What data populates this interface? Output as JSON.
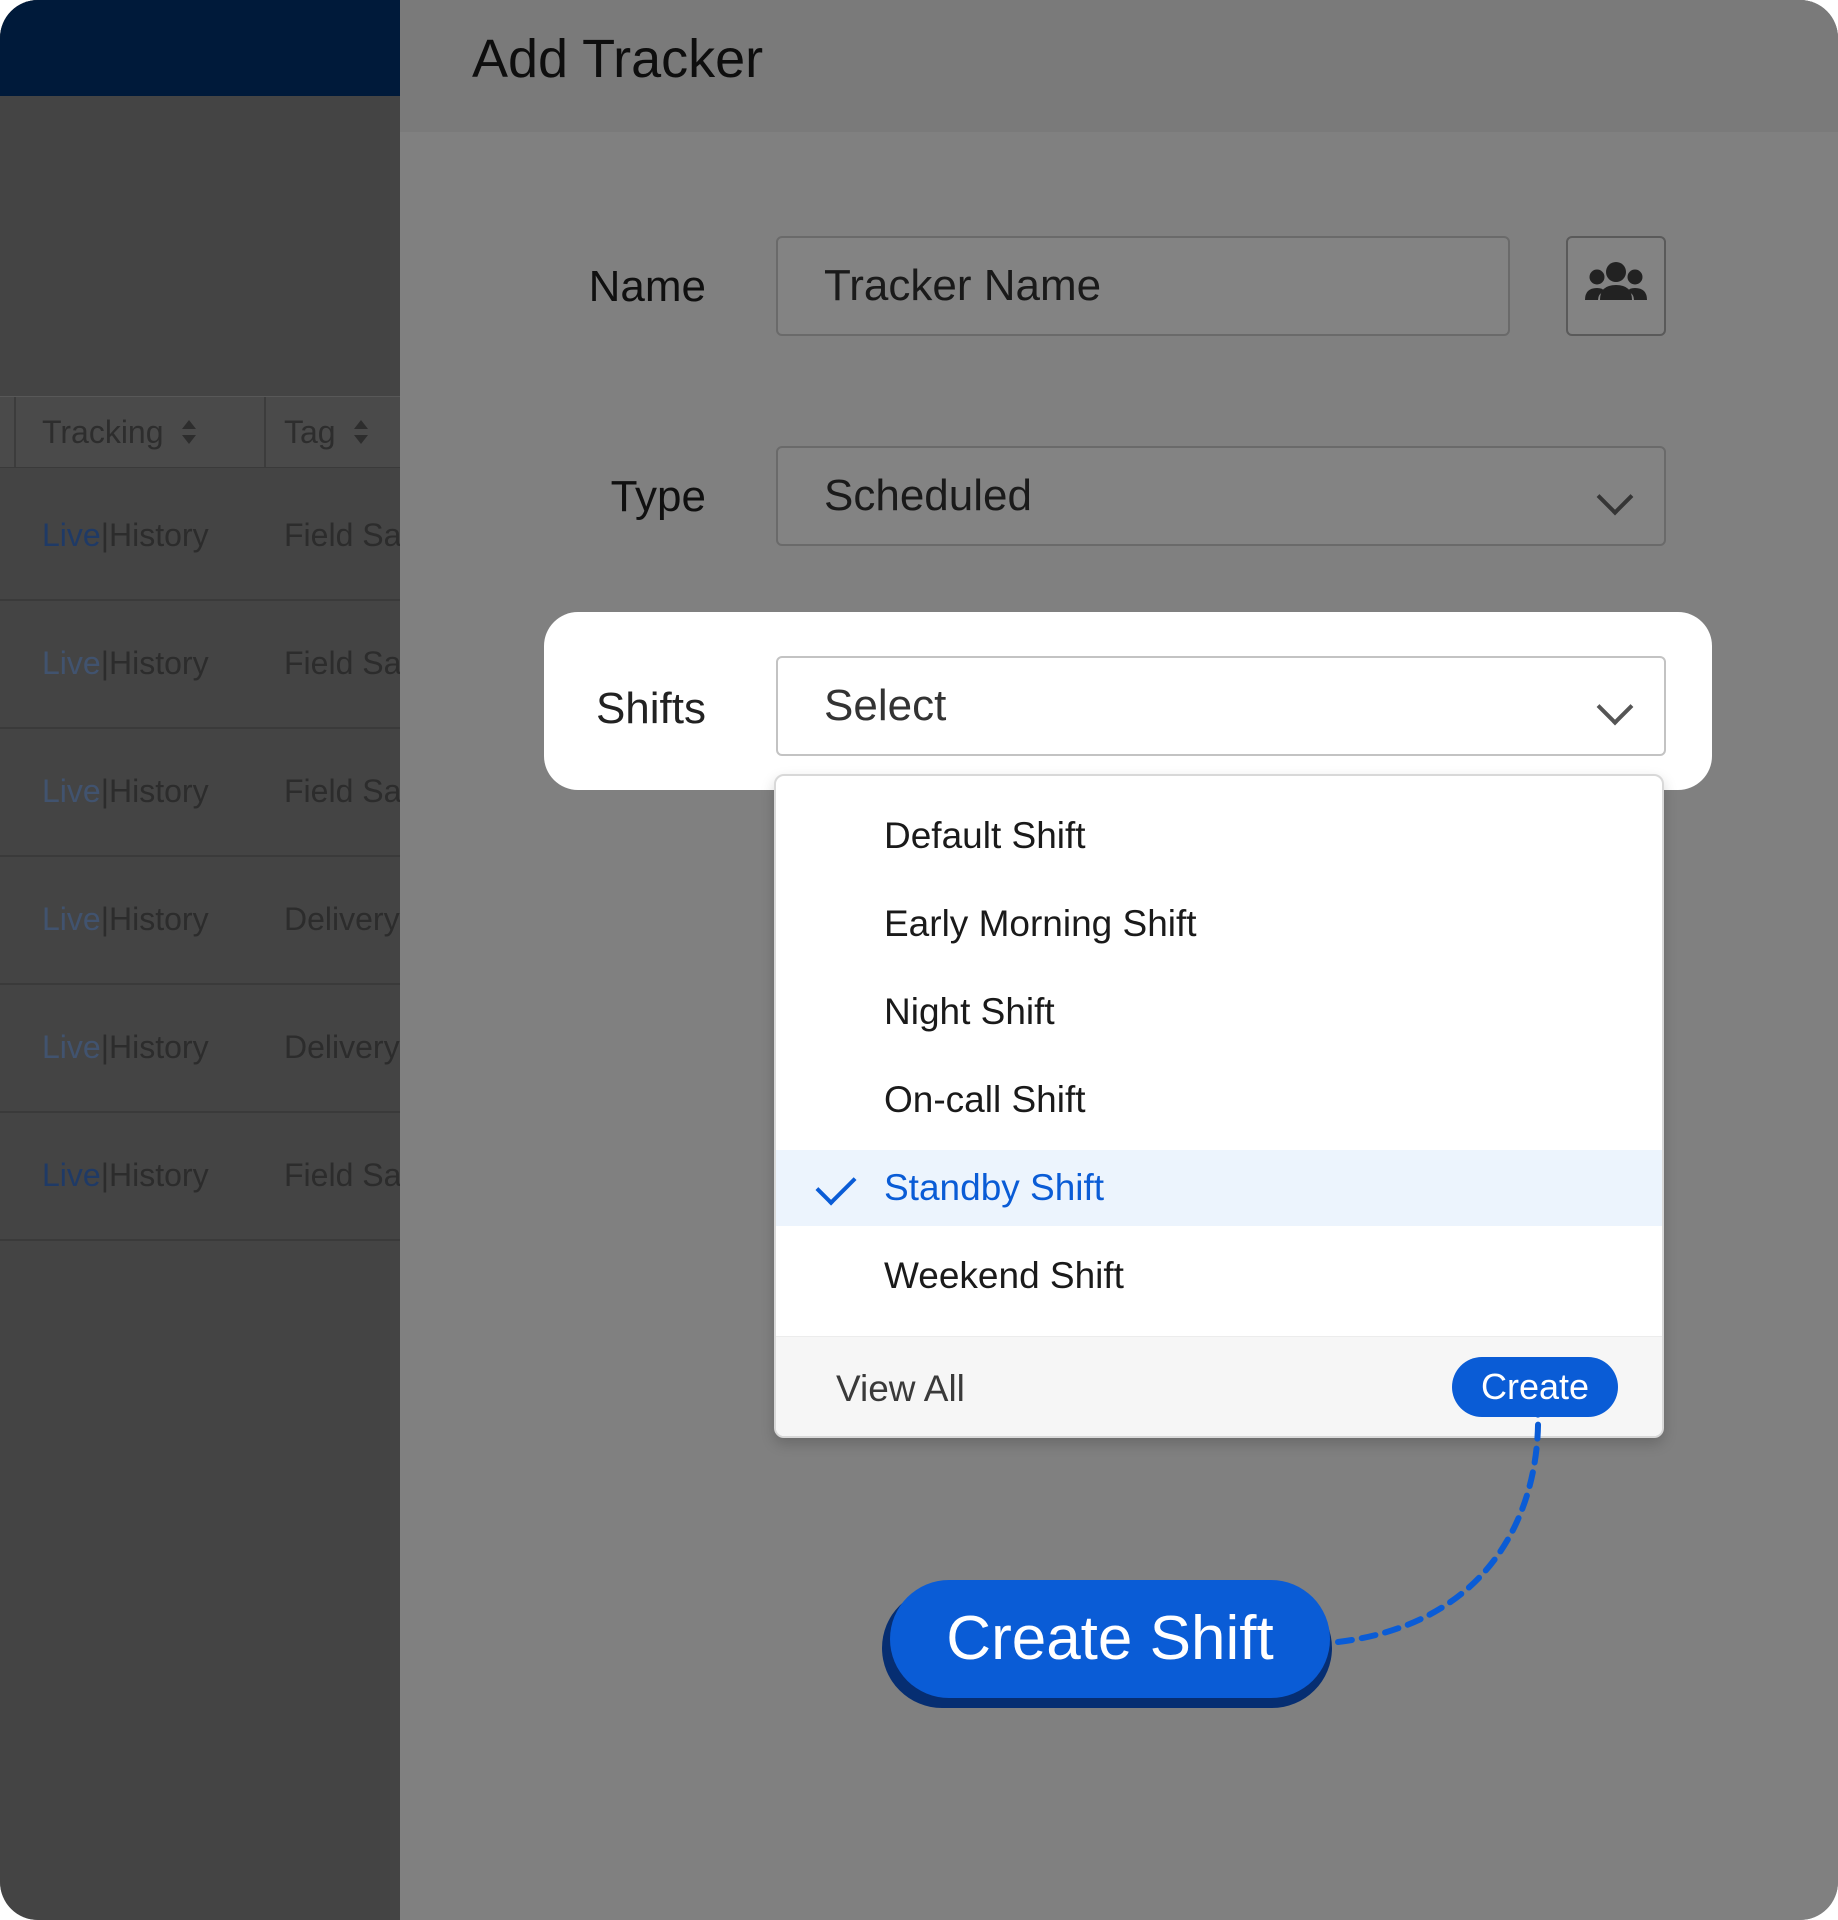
{
  "background_table": {
    "columns": [
      "Tracking",
      "Tag"
    ],
    "rows": [
      {
        "live": "Live",
        "separator": "|",
        "history": "History",
        "tag": "Field Sa"
      },
      {
        "live": "Live",
        "separator": "|",
        "history": "History",
        "tag": "Field Sa"
      },
      {
        "live": "Live",
        "separator": "|",
        "history": "History",
        "tag": "Field Sa"
      },
      {
        "live": "Live",
        "separator": "|",
        "history": "History",
        "tag": "Delivery"
      },
      {
        "live": "Live",
        "separator": "|",
        "history": "History",
        "tag": "Delivery"
      },
      {
        "live": "Live",
        "separator": "|",
        "history": "History",
        "tag": "Field Sa"
      }
    ]
  },
  "modal": {
    "title": "Add Tracker",
    "name_label": "Name",
    "name_placeholder": "Tracker Name",
    "type_label": "Type",
    "type_value": "Scheduled",
    "shifts_label": "Shifts",
    "shifts_value": "Select"
  },
  "dropdown": {
    "options": [
      {
        "label": "Default Shift",
        "selected": false
      },
      {
        "label": "Early Morning Shift",
        "selected": false
      },
      {
        "label": "Night Shift",
        "selected": false
      },
      {
        "label": "On-call Shift",
        "selected": false
      },
      {
        "label": "Standby Shift",
        "selected": true
      },
      {
        "label": "Weekend Shift",
        "selected": false
      }
    ],
    "view_all": "View All",
    "create": "Create"
  },
  "callout": {
    "label": "Create Shift"
  },
  "colors": {
    "accent": "#0a5cd6",
    "topbar": "#001a3a",
    "selected_bg": "#ecf4fd"
  }
}
